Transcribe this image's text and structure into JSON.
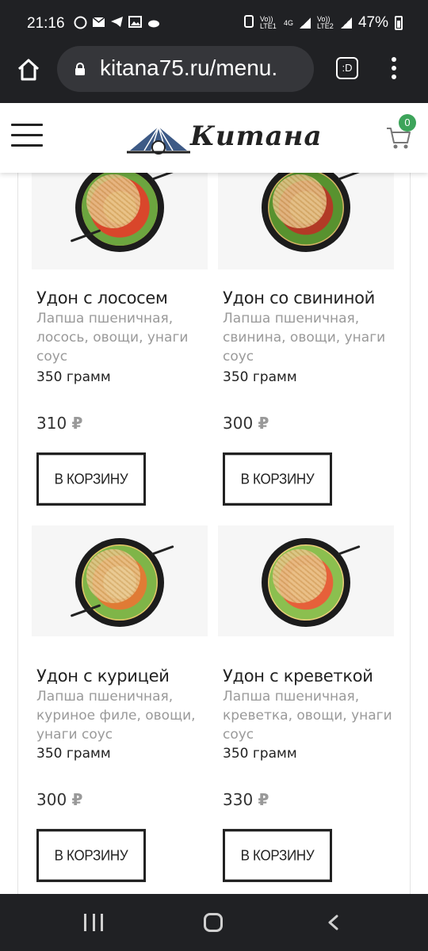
{
  "status_bar": {
    "time": "21:16",
    "net1": "Vo)) LTE1",
    "net_type": "4G",
    "net2": "Vo)) LTE2",
    "battery": "47%"
  },
  "browser": {
    "url": "kitana75.ru/menu.",
    "tabs_label": ":D"
  },
  "header": {
    "logo_text": "Китана",
    "cart_count": "0"
  },
  "products": [
    {
      "title": "Удон с лососем",
      "desc": "Лапша пшеничная, лосось, овощи, унаги соус",
      "weight": "350 грамм",
      "price": "310",
      "currency": "₽",
      "button": "В КОРЗИНУ"
    },
    {
      "title": "Удон со свининой",
      "desc": "Лапша пшеничная, свинина, овощи, унаги соус",
      "weight": "350 грамм",
      "price": "300",
      "currency": "₽",
      "button": "В КОРЗИНУ"
    },
    {
      "title": "Удон с курицей",
      "desc": "Лапша пшеничная, куриное филе, овощи, унаги соус",
      "weight": "350 грамм",
      "price": "300",
      "currency": "₽",
      "button": "В КОРЗИНУ"
    },
    {
      "title": "Удон с креветкой",
      "desc": "Лапша пшеничная, креветка, овощи, унаги соус",
      "weight": "350 грамм",
      "price": "330",
      "currency": "₽",
      "button": "В КОРЗИНУ"
    }
  ],
  "colors": {
    "badge": "#3da45a",
    "text": "#222222",
    "muted": "#9a9a9a"
  }
}
